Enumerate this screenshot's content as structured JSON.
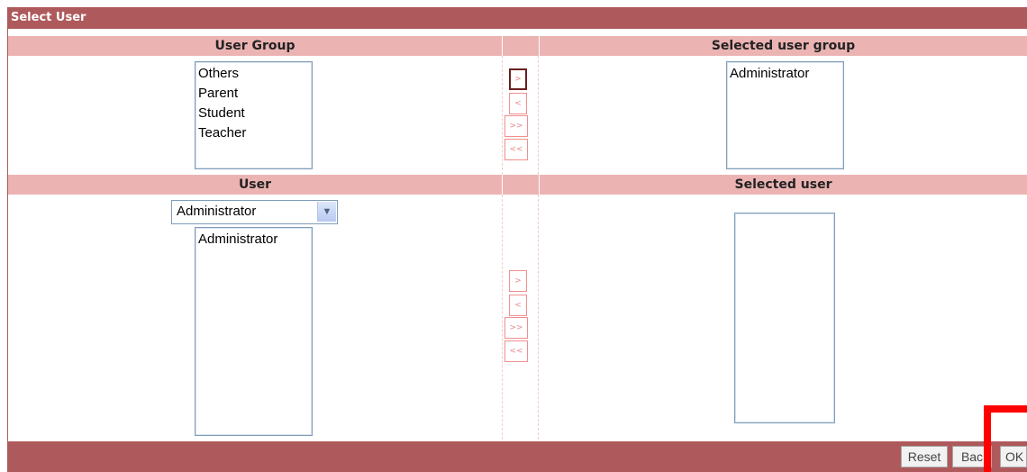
{
  "title": "Select User",
  "group_section": {
    "left_header": "User Group",
    "right_header": "Selected user group",
    "available": [
      "Others",
      "Parent",
      "Student",
      "Teacher"
    ],
    "selected": [
      "Administrator"
    ],
    "buttons": [
      ">",
      "<",
      ">>",
      "<<"
    ]
  },
  "user_section": {
    "left_header": "User",
    "right_header": "Selected user",
    "group_select_value": "Administrator",
    "available": [
      "Administrator"
    ],
    "selected": [],
    "buttons": [
      ">",
      "<",
      ">>",
      "<<"
    ]
  },
  "footer": {
    "reset_label": "Reset",
    "back_label": "Bac",
    "ok_label": "OK"
  },
  "colors": {
    "bar": "#ae5a5c",
    "header": "#ecb3b3",
    "highlight": "#ff0000"
  }
}
